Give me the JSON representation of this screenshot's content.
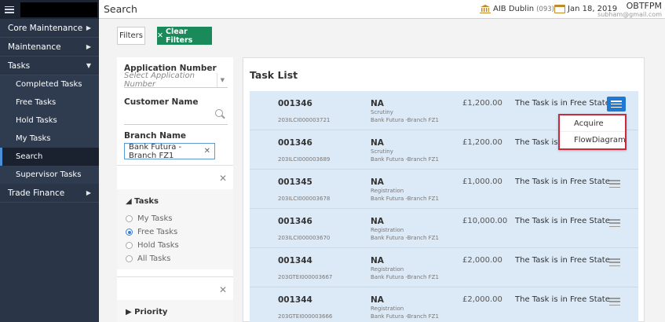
{
  "sidebar": {
    "items": [
      {
        "label": "Core Maintenance"
      },
      {
        "label": "Maintenance"
      },
      {
        "label": "Tasks"
      },
      {
        "label": "Trade Finance"
      }
    ],
    "subitems": [
      {
        "label": "Completed Tasks"
      },
      {
        "label": "Free Tasks"
      },
      {
        "label": "Hold Tasks"
      },
      {
        "label": "My Tasks"
      },
      {
        "label": "Search"
      },
      {
        "label": "Supervisor Tasks"
      }
    ]
  },
  "header": {
    "title": "Search",
    "branch": "AIB Dublin",
    "branch_code": "(093)",
    "date": "Jan 18, 2019",
    "user": "OBTFPM",
    "email": "subham@gmail.com"
  },
  "toolbar": {
    "filters_label": "Filters",
    "clear_label": "Clear Filters"
  },
  "filters": {
    "application_number_label": "Application Number",
    "application_number_placeholder": "Select Application Number",
    "customer_name_label": "Customer Name",
    "branch_name_label": "Branch Name",
    "branch_chip": "Bank Futura -Branch FZ1",
    "tasks_label": "Tasks",
    "task_options": [
      {
        "label": "My Tasks",
        "selected": false
      },
      {
        "label": "Free Tasks",
        "selected": true
      },
      {
        "label": "Hold Tasks",
        "selected": false
      },
      {
        "label": "All Tasks",
        "selected": false
      }
    ],
    "priority_label": "Priority"
  },
  "task_list": {
    "title": "Task List",
    "rows": [
      {
        "number": "001346",
        "ref": "203ILCI000003721",
        "na": "NA",
        "stage": "Scrutiny",
        "branch": "Bank Futura -Branch FZ1",
        "amount": "£1,200.00",
        "status": "The Task is in Free State"
      },
      {
        "number": "001346",
        "ref": "203ILCI000003689",
        "na": "NA",
        "stage": "Scrutiny",
        "branch": "Bank Futura -Branch FZ1",
        "amount": "£1,200.00",
        "status": "The Task is in"
      },
      {
        "number": "001345",
        "ref": "203ILCI000003678",
        "na": "NA",
        "stage": "Registration",
        "branch": "Bank Futura -Branch FZ1",
        "amount": "£1,000.00",
        "status": "The Task is in Free State"
      },
      {
        "number": "001346",
        "ref": "203ILCI000003670",
        "na": "NA",
        "stage": "Registration",
        "branch": "Bank Futura -Branch FZ1",
        "amount": "£10,000.00",
        "status": "The Task is in Free State"
      },
      {
        "number": "001344",
        "ref": "203GTEI000003667",
        "na": "NA",
        "stage": "Registration",
        "branch": "Bank Futura -Branch FZ1",
        "amount": "£2,000.00",
        "status": "The Task is in Free State"
      },
      {
        "number": "001344",
        "ref": "203GTEI000003666",
        "na": "NA",
        "stage": "Registration",
        "branch": "Bank Futura -Branch FZ1",
        "amount": "£2,000.00",
        "status": "The Task is in Free State"
      }
    ]
  },
  "row_menu": {
    "items": [
      {
        "label": "Acquire"
      },
      {
        "label": "FlowDiagram"
      }
    ]
  },
  "colors": {
    "sidebar": "#2a3547",
    "accent_green": "#1b8a5a",
    "accent_blue": "#1f78d1",
    "highlight_red": "#d0283a",
    "row_bg": "#dce9f7"
  }
}
